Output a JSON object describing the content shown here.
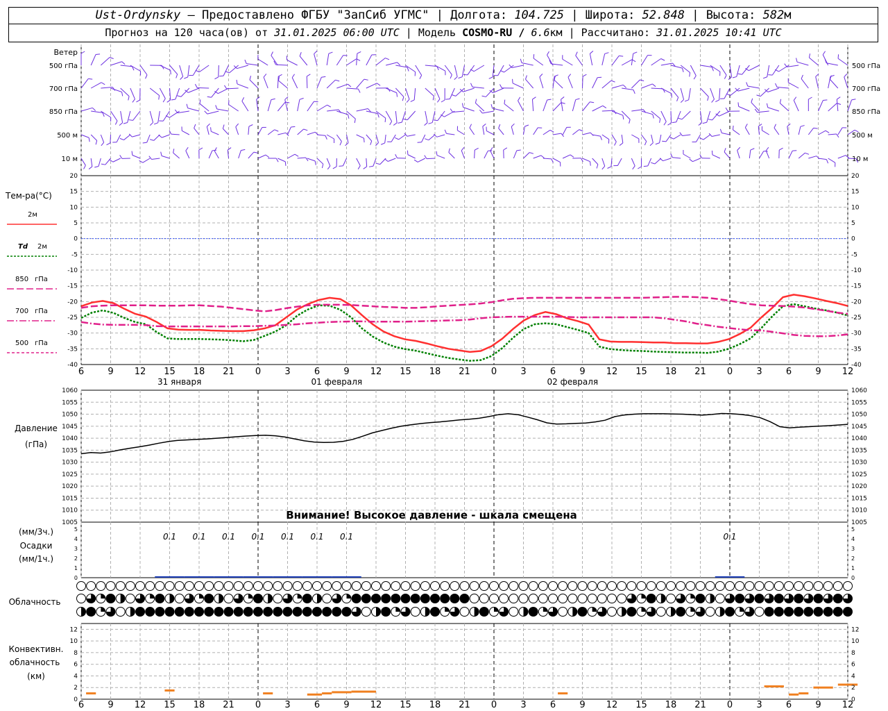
{
  "header": {
    "station": "Ust-Ordynsky",
    "provider": " — Предоставлено ФГБУ \"ЗапСиб УГМС\" | Долгота: ",
    "lon": "104.725",
    "lat_label": " | Широта: ",
    "lat": "52.848",
    "alt_label": " | Высота: ",
    "alt": "582",
    "alt_unit": "м",
    "forecast_label": "Прогноз на 120 часа(ов) от ",
    "start_time": "31.01.2025 06:00 UTC",
    "model_label": "  | Модель ",
    "model": "COSMO-RU / ",
    "resolution": "6.6",
    "res_unit": "км",
    "calc_label": " | Рассчитано: ",
    "calc_time": "31.01.2025 10:41 UTC"
  },
  "wind": {
    "title": "Ветер",
    "levels": [
      "500 гПа",
      "700 гПа",
      "850 гПа",
      "500 м",
      "10  м"
    ]
  },
  "temp": {
    "title": "Тем-ра(°C)",
    "legend": [
      {
        "main": "",
        "sub": "2м",
        "color": "#ff3030",
        "dash": ""
      },
      {
        "main": "Td",
        "sub": "2м",
        "color": "#008000",
        "dash": "3,2"
      },
      {
        "main": "850",
        "sub": "гПа",
        "color": "#e0208a",
        "dash": "10,4"
      },
      {
        "main": "700",
        "sub": "гПа",
        "color": "#e0208a",
        "dash": "10,3,2,3"
      },
      {
        "main": "500",
        "sub": "гПа",
        "color": "#e0208a",
        "dash": "4,3"
      }
    ]
  },
  "pressure": {
    "title1": "Давление",
    "title2": "(гПа)",
    "warning": "Внимание! Высокое давление - шкала смещена"
  },
  "precip": {
    "label1": "(мм/3ч.)",
    "label2": "Осадки",
    "label3": "(мм/1ч.)"
  },
  "cloud": {
    "title": "Облачность"
  },
  "conv": {
    "title1": "Конвективн.",
    "title2": "облачность",
    "title3": "(км)"
  },
  "time_axis": {
    "hour_labels": [
      "6",
      "9",
      "12",
      "15",
      "18",
      "21",
      "0",
      "3",
      "6",
      "9",
      "12",
      "15",
      "18",
      "21",
      "0",
      "3",
      "6",
      "9",
      "12",
      "15",
      "18",
      "21",
      "0",
      "3",
      "6",
      "9",
      "12"
    ],
    "day_labels": [
      "31 января",
      "01 февраля",
      "02 февраля"
    ]
  },
  "chart_data": [
    {
      "type": "line",
      "title": "Тем-ра(°C)",
      "x_hours": [
        0,
        1,
        2,
        3,
        4,
        5,
        6,
        7,
        8,
        9,
        10,
        11,
        12,
        13,
        14,
        15,
        16,
        17,
        18,
        19,
        20,
        21,
        22,
        23,
        24,
        25,
        26,
        27,
        28,
        29,
        30,
        31,
        32,
        33,
        34,
        35,
        36,
        37,
        38,
        39,
        40,
        41,
        42,
        43,
        44,
        45,
        46,
        47,
        48,
        49,
        50,
        51,
        52,
        53,
        54,
        55,
        56,
        57,
        58,
        59,
        60,
        61,
        62,
        63,
        64,
        65,
        66,
        67,
        68,
        69,
        70,
        71,
        72,
        73,
        74,
        75,
        76,
        77,
        78
      ],
      "ylim": [
        -40,
        20
      ],
      "yticks": [
        20,
        15,
        10,
        5,
        0,
        -5,
        -10,
        -15,
        -20,
        -25,
        -30,
        -35,
        -40
      ],
      "series": [
        {
          "name": "2м",
          "values": [
            -21.5,
            -20.3,
            -19.8,
            -20.5,
            -22.3,
            -23.9,
            -24.8,
            -26.5,
            -28.5,
            -28.9,
            -29,
            -29,
            -29.2,
            -29.3,
            -29.4,
            -29.4,
            -29.1,
            -28.5,
            -27.5,
            -25,
            -22.5,
            -20.8,
            -19.5,
            -18.8,
            -19.2,
            -21.2,
            -24.3,
            -27.2,
            -29.5,
            -31,
            -32,
            -32.5,
            -33.3,
            -34.2,
            -35,
            -35.5,
            -36,
            -35.7,
            -34.2,
            -31.8,
            -28.7,
            -26,
            -24.3,
            -23.3,
            -24,
            -25.3,
            -26.2,
            -27.3,
            -32,
            -32.7,
            -32.8,
            -32.8,
            -32.9,
            -33,
            -33,
            -33.2,
            -33.2,
            -33.3,
            -33.3,
            -32.8,
            -31.9,
            -30.3,
            -28.3,
            -25,
            -22,
            -18.6,
            -17.8,
            -18.3,
            -19,
            -19.8,
            -20.5,
            -21.4
          ],
          "color": "#ff3030"
        },
        {
          "name": "Td 2м",
          "values": [
            -25.2,
            -23.5,
            -22.8,
            -23.6,
            -25.2,
            -26.5,
            -27.2,
            -29.7,
            -31.7,
            -31.9,
            -31.9,
            -31.9,
            -32,
            -32.1,
            -32.3,
            -32.6,
            -32.2,
            -30.9,
            -29.5,
            -27.5,
            -24.5,
            -22.5,
            -21.2,
            -21.3,
            -22.6,
            -25,
            -28.5,
            -31.1,
            -33,
            -34.3,
            -35.1,
            -35.6,
            -36.4,
            -37.2,
            -37.9,
            -38.4,
            -38.8,
            -38.6,
            -37.3,
            -34.8,
            -31.5,
            -28.7,
            -27.2,
            -26.9,
            -27.2,
            -28.1,
            -29,
            -30,
            -34.3,
            -35.1,
            -35.4,
            -35.6,
            -35.7,
            -35.9,
            -36,
            -36.1,
            -36.2,
            -36.2,
            -36.3,
            -35.9,
            -35,
            -33.5,
            -31.7,
            -28.4,
            -24.7,
            -21.5,
            -20.8,
            -21.5,
            -22.2,
            -22.8,
            -23.5,
            -24.4
          ],
          "color": "#008000"
        },
        {
          "name": "850 гПа",
          "values": [
            -22,
            -21.5,
            -21.3,
            -21.2,
            -21.2,
            -21.2,
            -21.2,
            -21.3,
            -21.3,
            -21.3,
            -21.2,
            -21.2,
            -21.4,
            -21.6,
            -22,
            -22.4,
            -22.8,
            -23.1,
            -22.7,
            -22.1,
            -21.6,
            -21.2,
            -21,
            -21,
            -21,
            -21.1,
            -21.3,
            -21.5,
            -21.7,
            -21.8,
            -22,
            -22,
            -21.8,
            -21.5,
            -21.3,
            -21.1,
            -20.9,
            -20.6,
            -20.2,
            -19.6,
            -19.1,
            -18.9,
            -18.8,
            -18.8,
            -18.8,
            -18.8,
            -18.8,
            -18.8,
            -18.8,
            -18.8,
            -18.8,
            -18.8,
            -18.8,
            -18.7,
            -18.6,
            -18.5,
            -18.5,
            -18.6,
            -18.8,
            -19.2,
            -19.7,
            -20.3,
            -20.8,
            -21.2,
            -21.3,
            -21.4,
            -21.6,
            -21.9,
            -22.4,
            -22.9,
            -23.5,
            -23.9
          ],
          "color": "#e0208a"
        },
        {
          "name": "700 гПа",
          "values": [
            -26.5,
            -27,
            -27.3,
            -27.4,
            -27.4,
            -27.4,
            -27.5,
            -27.8,
            -27.9,
            -27.9,
            -27.9,
            -27.9,
            -27.9,
            -27.9,
            -27.9,
            -27.8,
            -27.8,
            -27.7,
            -27.6,
            -27.4,
            -27.2,
            -26.9,
            -26.7,
            -26.5,
            -26.4,
            -26.3,
            -26.3,
            -26.4,
            -26.4,
            -26.4,
            -26.4,
            -26.3,
            -26.2,
            -26.1,
            -26,
            -25.9,
            -25.7,
            -25.3,
            -25,
            -24.9,
            -24.8,
            -24.8,
            -24.8,
            -24.8,
            -24.8,
            -24.9,
            -25,
            -25,
            -25,
            -25,
            -25,
            -25,
            -25,
            -25,
            -25.3,
            -25.8,
            -26.3,
            -27,
            -27.5,
            -28,
            -28.4,
            -28.8,
            -29.1,
            -29.2,
            -29.6,
            -30.1,
            -30.6,
            -30.9,
            -31,
            -31,
            -30.8,
            -30.4
          ],
          "color": "#e0208a"
        }
      ]
    },
    {
      "type": "line",
      "title": "Давление (гПа)",
      "ylim": [
        1005,
        1060
      ],
      "yticks": [
        1060,
        1055,
        1050,
        1045,
        1040,
        1035,
        1030,
        1025,
        1020,
        1015,
        1010,
        1005
      ],
      "series": [
        {
          "name": "Давление",
          "values": [
            1033.5,
            1034,
            1033.8,
            1034.3,
            1035.1,
            1035.8,
            1036.4,
            1037.1,
            1037.9,
            1038.6,
            1039.1,
            1039.3,
            1039.5,
            1039.7,
            1040,
            1040.3,
            1040.6,
            1040.9,
            1041.1,
            1041.2,
            1041,
            1040.5,
            1039.7,
            1038.9,
            1038.4,
            1038.2,
            1038.3,
            1038.7,
            1039.5,
            1040.8,
            1042.2,
            1043.2,
            1044.2,
            1045,
            1045.6,
            1046.1,
            1046.5,
            1046.8,
            1047.2,
            1047.6,
            1047.9,
            1048.3,
            1049,
            1049.8,
            1050.2,
            1049.8,
            1048.8,
            1047.7,
            1046.4,
            1045.9,
            1046,
            1046.2,
            1046.3,
            1046.8,
            1047.5,
            1049,
            1049.7,
            1050,
            1050.2,
            1050.2,
            1050.2,
            1050.1,
            1050,
            1049.8,
            1049.6,
            1049.9,
            1050.3,
            1050.2,
            1049.9,
            1049.4,
            1048.5,
            1046.9,
            1044.8,
            1044.3,
            1044.6,
            1044.8,
            1045,
            1045.2,
            1045.5,
            1045.8
          ]
        }
      ]
    },
    {
      "type": "bar",
      "title": "Осадки (мм/3ч.)",
      "ylim": [
        0,
        5
      ],
      "yticks": [
        5,
        4,
        3,
        2,
        1,
        0
      ],
      "labels": [
        {
          "hour": 9,
          "text": "0.1"
        },
        {
          "hour": 12,
          "text": "0.1"
        },
        {
          "hour": 15,
          "text": "0.1"
        },
        {
          "hour": 18,
          "text": "0.1"
        },
        {
          "hour": 21,
          "text": "0.1"
        },
        {
          "hour": 24,
          "text": "0.1"
        },
        {
          "hour": 27,
          "text": "0.1"
        },
        {
          "hour": 66,
          "text": "0.1"
        }
      ]
    },
    {
      "type": "bar",
      "title": "Конвективн. облачность (км)",
      "ylim": [
        0,
        13
      ],
      "yticks": [
        12,
        10,
        8,
        6,
        4,
        2,
        0
      ],
      "segments": [
        {
          "x0": 0.5,
          "x1": 1.5,
          "y": 1
        },
        {
          "x0": 8.5,
          "x1": 9.5,
          "y": 1.5
        },
        {
          "x0": 18.5,
          "x1": 19.5,
          "y": 1
        },
        {
          "x0": 23,
          "x1": 24.5,
          "y": 0.8
        },
        {
          "x0": 24.5,
          "x1": 25.5,
          "y": 1
        },
        {
          "x0": 25.5,
          "x1": 27.5,
          "y": 1.2
        },
        {
          "x0": 27.5,
          "x1": 30,
          "y": 1.3
        },
        {
          "x0": 48.5,
          "x1": 49.5,
          "y": 1
        },
        {
          "x0": 69.5,
          "x1": 71.5,
          "y": 2.2
        },
        {
          "x0": 72,
          "x1": 73,
          "y": 0.8
        },
        {
          "x0": 73,
          "x1": 74,
          "y": 1
        },
        {
          "x0": 74.5,
          "x1": 76.5,
          "y": 2
        },
        {
          "x0": 77,
          "x1": 79,
          "y": 2.5
        }
      ]
    },
    {
      "type": "table",
      "title": "Облачность",
      "rows": [
        {
          "name": "row1",
          "note": "nearly all clear"
        },
        {
          "name": "row2",
          "note": "partial/overcast mid-level"
        },
        {
          "name": "row3",
          "note": "varied/low clouds"
        }
      ]
    }
  ],
  "colors": {
    "wind": "#6b2ee0",
    "temp_2m": "#ff3030",
    "td": "#008000",
    "upper": "#e0208a",
    "zero_line": "#3050ff",
    "pressure": "#000000",
    "precip": "#1a3bb3",
    "conv": "#f08020"
  }
}
